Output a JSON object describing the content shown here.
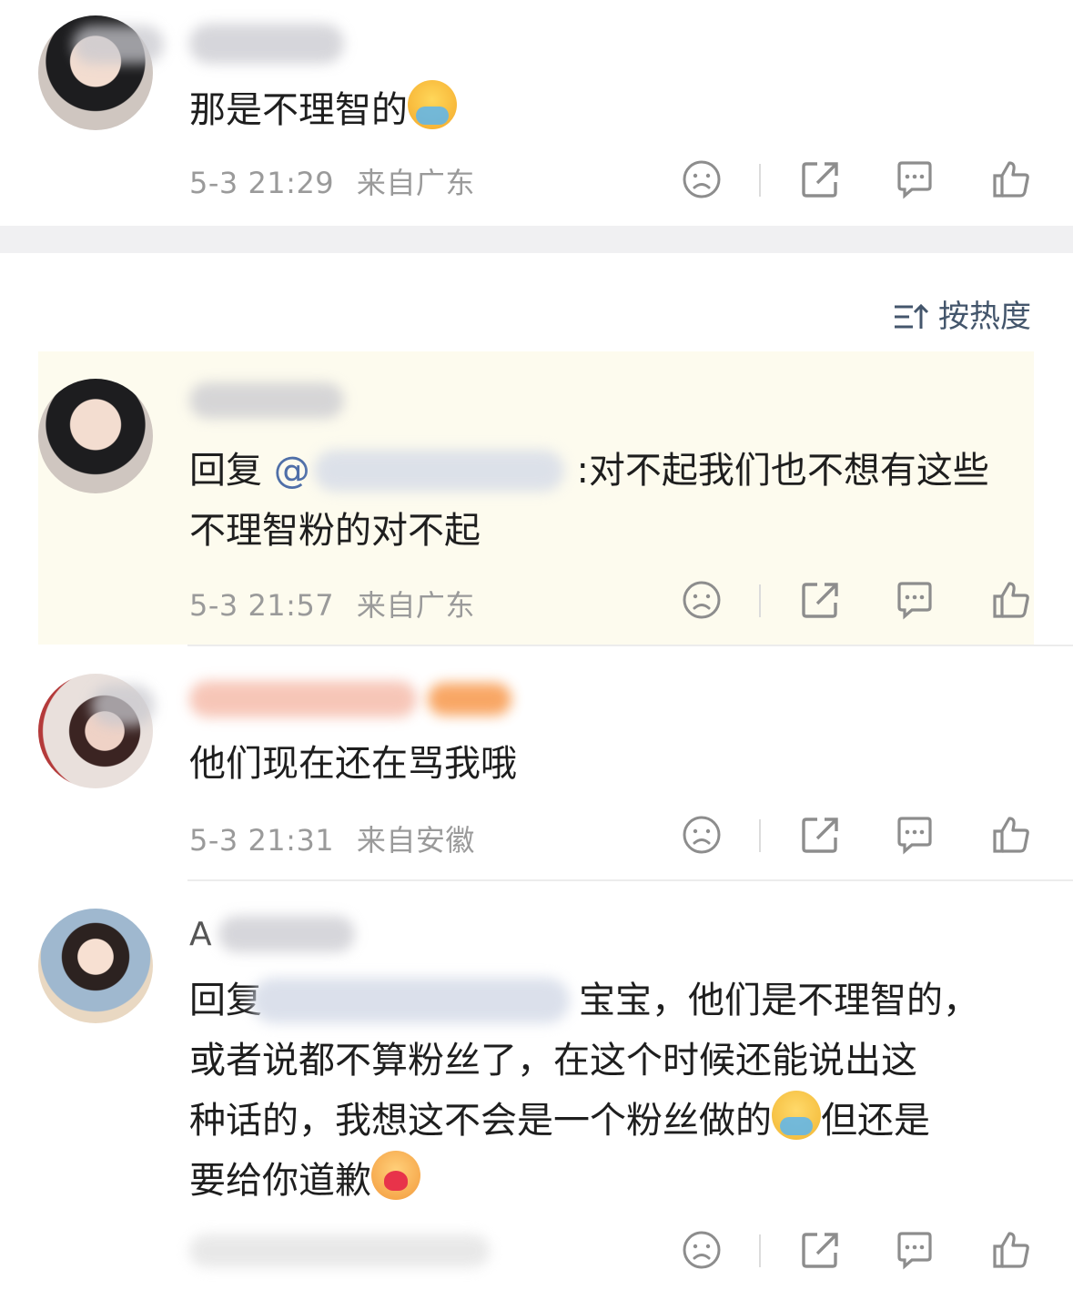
{
  "comments": [
    {
      "text": "那是不理智的",
      "time": "5-3 21:29",
      "location": "来自广东"
    },
    {
      "reply_prefix": "回复",
      "mention": "@",
      "reply_body_line1": ":对不起我们也不想有这些",
      "reply_body_line2": "不理智粉的对不起",
      "time": "5-3 21:57",
      "location": "来自广东"
    },
    {
      "text": "他们现在还在骂我哦",
      "time": "5-3 21:31",
      "location": "来自安徽"
    },
    {
      "name_prefix": "A",
      "reply_prefix": "回复",
      "line1_visible": "宝宝，他们是不理智的，",
      "line2": "或者说都不算粉丝了，在这个时候还能说出这",
      "line3_a": "种话的，我想这不会是一个粉丝做的",
      "line3_b": "但还是",
      "line4": "要给你道歉"
    }
  ],
  "sort": {
    "label": "按热度"
  },
  "icons": [
    "dislike-icon",
    "share-icon",
    "comment-icon",
    "like-icon",
    "sort-icon"
  ]
}
